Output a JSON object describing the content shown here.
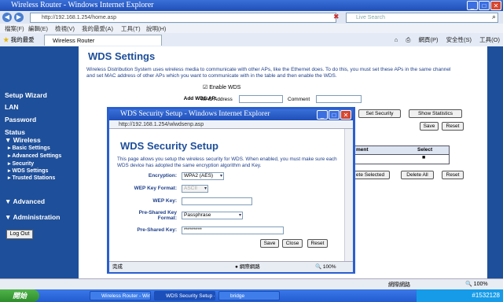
{
  "browser": {
    "title": "Wireless Router - Windows Internet Explorer",
    "url": "http://192.168.1.254/home.asp",
    "search_placeholder": "Live Search",
    "menu": [
      "檔案(F)",
      "編輯(E)",
      "檢視(V)",
      "我的最愛(A)",
      "工具(T)",
      "說明(H)"
    ],
    "favorites_label": "我的最愛",
    "tab_label": "Wireless Router",
    "tools": [
      "網頁(P)",
      "安全性(S)",
      "工具(O)"
    ],
    "status_zone": "網際網路",
    "zoom": "100%"
  },
  "sidebar": {
    "items": [
      "Setup Wizard",
      "LAN",
      "Password",
      "Status",
      "Wireless",
      "Advanced",
      "Administration"
    ],
    "wireless_sub": [
      "Basic Settings",
      "Advanced Settings",
      "Security",
      "WDS Settings",
      "Trusted Stations"
    ],
    "logout": "Log Out"
  },
  "main": {
    "title": "WDS Settings",
    "description": "Wireless Distribution System uses wireless media to communicate with other APs, like the Ethernet does. To do this, you must set these APs in the same channel and set MAC address of other APs which you want to communicate with in the table and then enable the WDS.",
    "enable_wds_label": "Enable WDS",
    "add_ap_label": "Add WDS AP:",
    "mac_label": "MAC Address",
    "comment_label": "Comment",
    "set_security": "Set Security",
    "show_statistics": "Show Statistics",
    "save": "Save",
    "reset": "Reset",
    "table_headers": [
      "ment",
      "Select"
    ],
    "delete_selected": "ete Selected",
    "delete_all": "Delete All",
    "reset2": "Reset"
  },
  "popup": {
    "title": "WDS Security Setup - Windows Internet Explorer",
    "url": "http://192.168.1.254/wlwdsenp.asp",
    "heading": "WDS Security Setup",
    "description": "This page allows you setup the wireless security for WDS. When enabled, you must make sure each WDS device has adopted the same encryption algorithm and Key.",
    "fields": {
      "encryption_label": "Encryption:",
      "encryption_value": "WPA2 (AES)",
      "wep_format_label": "WEP Key Format:",
      "wep_format_value": "ASCII",
      "wep_key_label": "WEP Key:",
      "psk_format_label1": "Pre-Shared Key",
      "psk_format_label2": "Format:",
      "psk_format_value": "Passphrase",
      "psk_label": "Pre-Shared Key:",
      "psk_value": "*********"
    },
    "buttons": {
      "save": "Save",
      "close": "Close",
      "reset": "Reset"
    },
    "status_left": "完成",
    "status_zone": "網際網路",
    "zoom": "100%"
  },
  "taskbar": {
    "start": "開始",
    "tasks": [
      "Wireless Router - Win...",
      "WDS Security Setup -...",
      "bridge"
    ],
    "watermark": "#1532128"
  }
}
